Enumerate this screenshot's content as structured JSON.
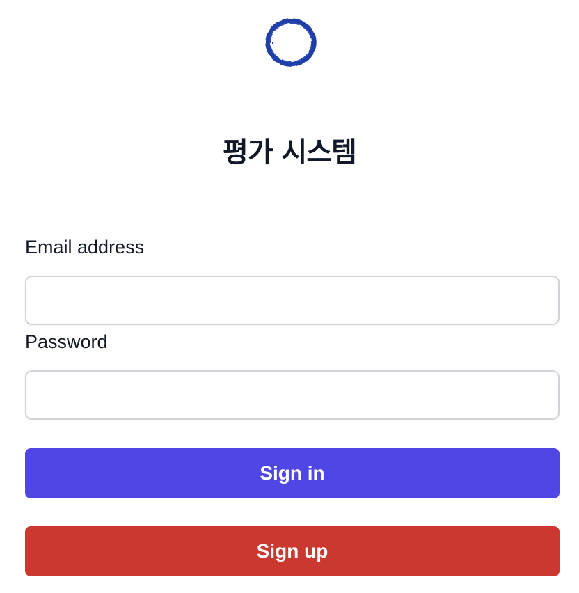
{
  "app": {
    "title": "평가 시스템",
    "logo_icon": "brush-circle-icon"
  },
  "form": {
    "email_label": "Email address",
    "email_value": "",
    "email_placeholder": "",
    "password_label": "Password",
    "password_value": "",
    "password_placeholder": "",
    "signin_label": "Sign in",
    "signup_label": "Sign up"
  },
  "colors": {
    "logo": "#1f3fa8",
    "signin_bg": "#4f46e5",
    "signup_bg": "#ca3830",
    "text": "#111827",
    "input_border": "#d1d5db"
  }
}
